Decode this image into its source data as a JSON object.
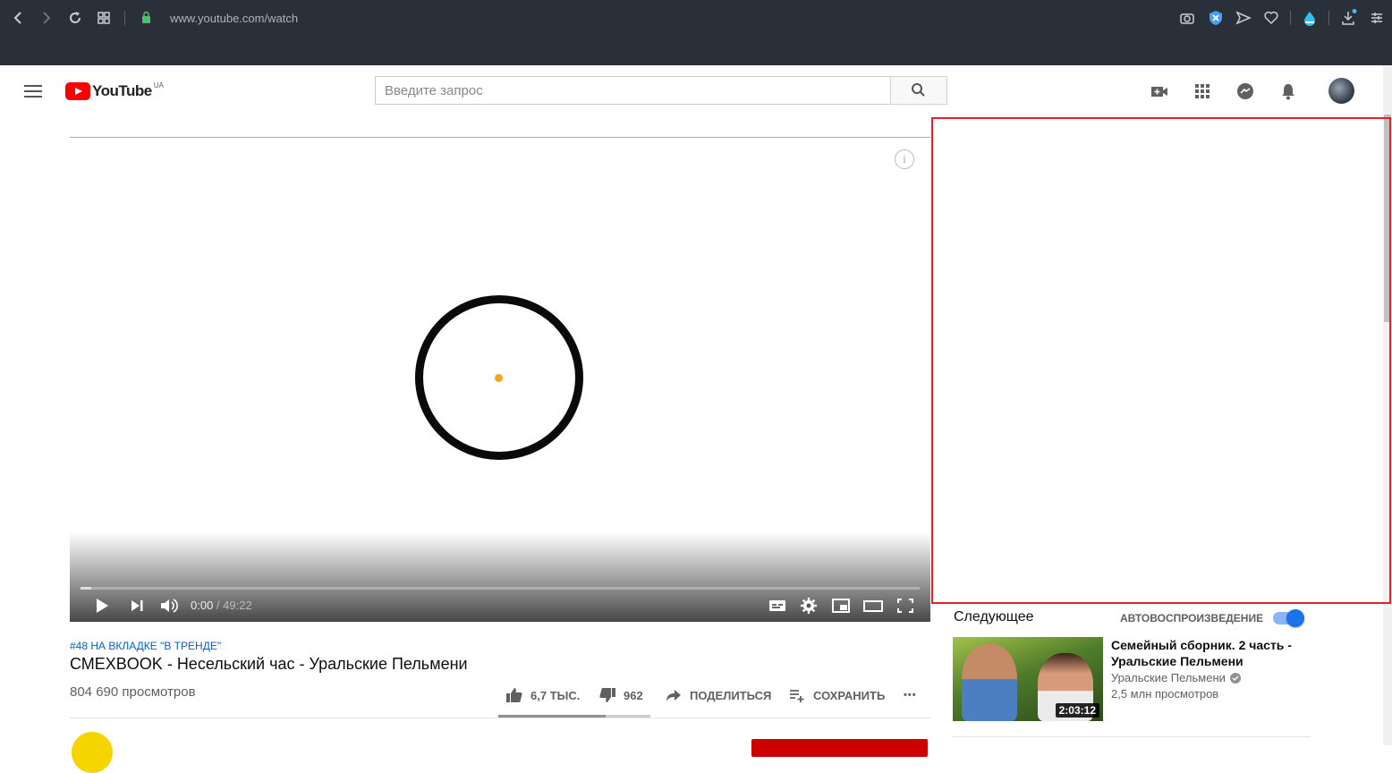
{
  "browser": {
    "url": "www.youtube.com/watch",
    "icons": [
      "back-icon",
      "forward-icon",
      "reload-icon",
      "grid-icon",
      "lock-icon",
      "camera-icon",
      "shield-icon",
      "send-icon",
      "heart-icon",
      "drop-icon",
      "download-icon",
      "menu-icon"
    ]
  },
  "header": {
    "logo_text": "YouTube",
    "logo_region": "UA",
    "search_placeholder": "Введите запрос",
    "icons": [
      "create-video-icon",
      "apps-icon",
      "messages-icon",
      "notifications-icon"
    ]
  },
  "player": {
    "current_time": "0:00",
    "time_separator": " / ",
    "duration": "49:22",
    "info_label": "i",
    "played_fraction": 0.0
  },
  "video": {
    "trend_label": "#48 НА ВКЛАДКЕ \"В ТРЕНДЕ\"",
    "title": "СМЕХBOOK - Несельский час - Уральские Пельмени",
    "views": "804 690 просмотров",
    "likes": "6,7 ТЫС.",
    "dislikes": "962",
    "share_label": "ПОДЕЛИТЬСЯ",
    "save_label": "СОХРАНИТЬ",
    "more_label": "•••"
  },
  "sidebar": {
    "up_next_label": "Следующее",
    "autoplay_label": "АВТОВОСПРОИЗВЕДЕНИЕ",
    "autoplay_on": true,
    "recommendations": [
      {
        "title": "Семейный сборник. 2 часть - Уральские Пельмени",
        "channel": "Уральские Пельмени",
        "views": "2,5 млн просмотров",
        "duration": "2:03:12"
      }
    ]
  },
  "colors": {
    "browser_bar": "#2a3039",
    "youtube_red": "#ff0000",
    "link_blue": "#065fd4",
    "ad_frame_red": "#e3202b",
    "toggle_blue": "#1a73e8"
  }
}
